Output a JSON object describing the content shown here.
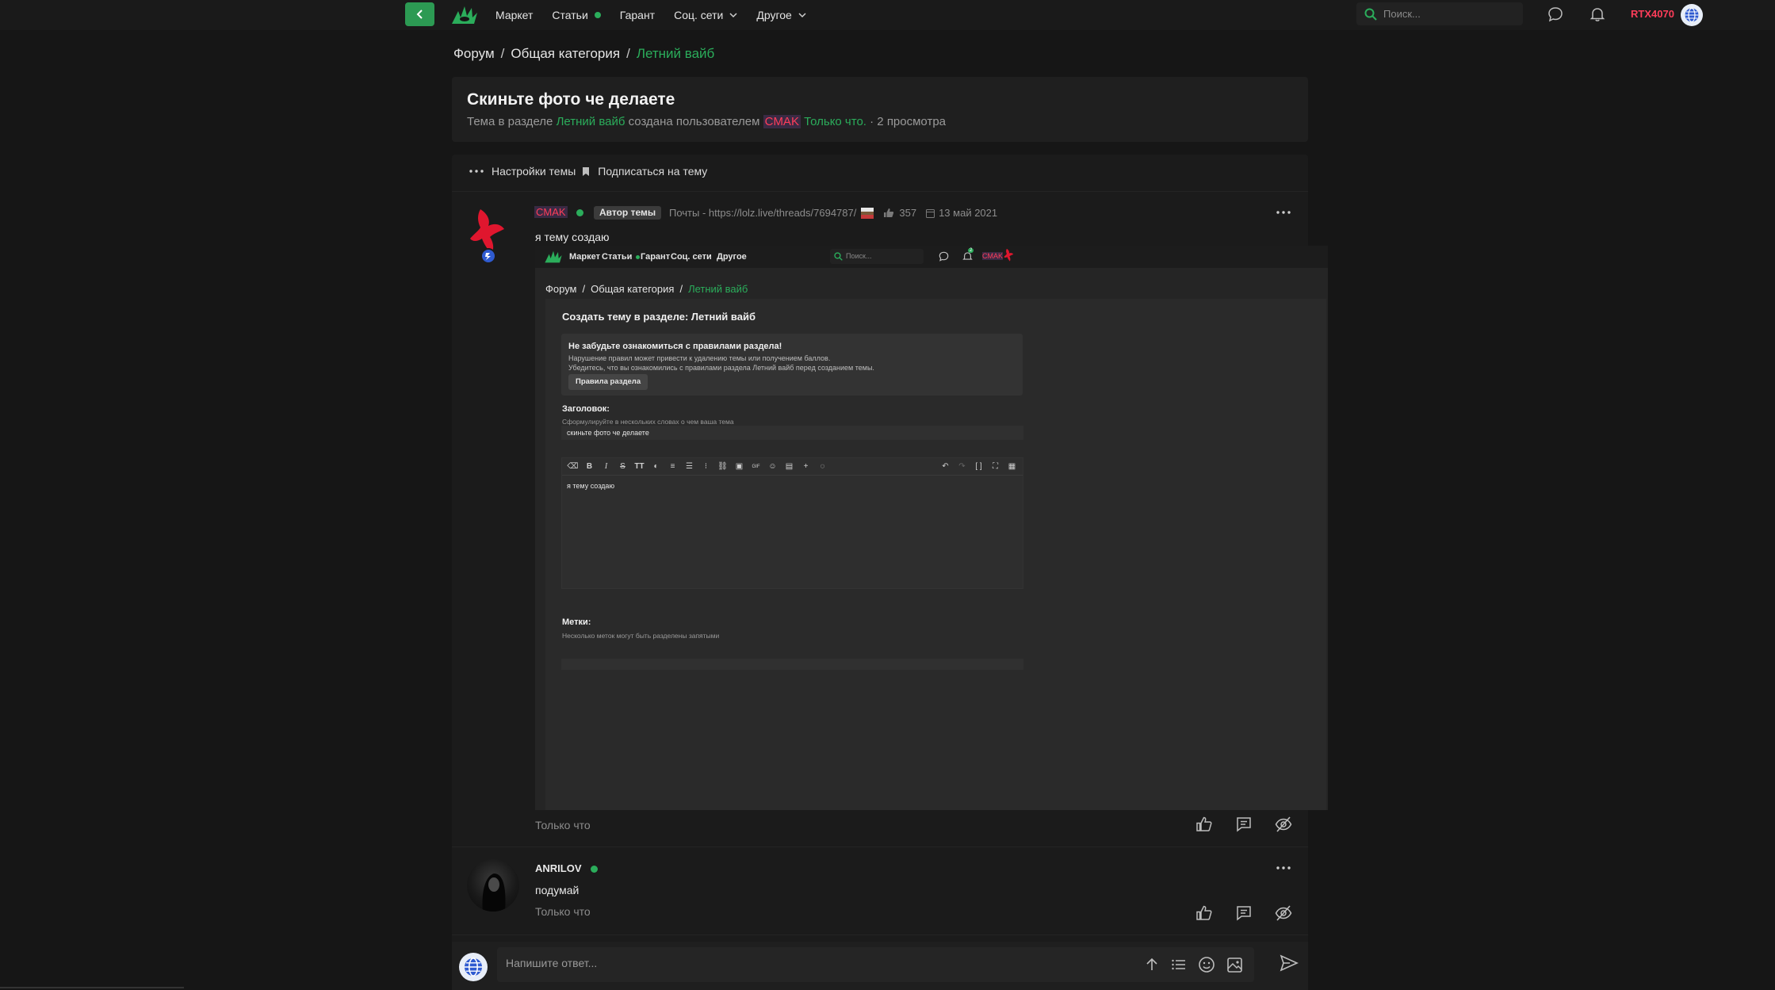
{
  "nav": {
    "items": [
      {
        "label": "Маркет",
        "dot": false,
        "chevron": false
      },
      {
        "label": "Статьи",
        "dot": true,
        "chevron": false
      },
      {
        "label": "Гарант",
        "dot": false,
        "chevron": false
      },
      {
        "label": "Соц. сети",
        "dot": false,
        "chevron": true
      },
      {
        "label": "Другое",
        "dot": false,
        "chevron": true
      }
    ],
    "search_placeholder": "Поиск...",
    "username": "RTX4070"
  },
  "breadcrumb": {
    "items": [
      "Форум",
      "Общая категория"
    ],
    "current": "Летний вайб",
    "sep": "/"
  },
  "thread": {
    "title": "Скиньте фото че делаете",
    "meta_prefix": "Тема в разделе",
    "meta_section": "Летний вайб",
    "meta_mid": "создана пользователем",
    "meta_user": "CMAK",
    "meta_time": "Только что.",
    "meta_views": "· 2 просмотра",
    "settings_label": "Настройки темы",
    "subscribe_label": "Подписаться на тему"
  },
  "posts": [
    {
      "user": "CMAK",
      "author_badge": "Автор темы",
      "title_text": "Почты - https://lolz.live/threads/7694787/",
      "likes": "357",
      "date": "13 май 2021",
      "text": "я тему создаю",
      "time": "Только что"
    },
    {
      "user": "ANRILOV",
      "text": "подумай",
      "time": "Только что"
    }
  ],
  "embedded": {
    "nav_items": [
      "Маркет",
      "Статьи",
      "Гарант",
      "Соц. сети",
      "Другое"
    ],
    "search_placeholder": "Поиск...",
    "username": "CMAK",
    "breadcrumb": [
      "Форум",
      "Общая категория"
    ],
    "breadcrumb_current": "Летний вайб",
    "sep": "/",
    "heading": "Создать тему в разделе: Летний вайб",
    "notice_title": "Не забудьте ознакомиться с правилами раздела!",
    "notice_line1": "Нарушение правил может привести к удалению темы или получением баллов.",
    "notice_line2": "Убедитесь, что вы ознакомились с правилами раздела Летний вайб перед созданием темы.",
    "notice_button": "Правила раздела",
    "title_label": "Заголовок:",
    "title_hint": "Сформулируйте в нескольких словах о чем ваша тема",
    "title_value": "скиньте фото че делаете",
    "body_value": "я тему создаю",
    "tags_label": "Метки:",
    "tags_hint": "Несколько меток могут быть разделены запятыми",
    "notif_count": "2"
  },
  "reply": {
    "placeholder": "Напишите ответ..."
  },
  "colors": {
    "accent": "#2bad5b",
    "nick": "#ff3d5a",
    "bg": "#161616",
    "card": "#1f1f1f"
  }
}
